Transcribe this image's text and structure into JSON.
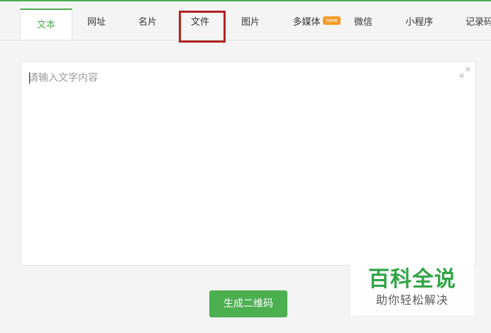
{
  "tabs": [
    {
      "label": "文本",
      "active": true
    },
    {
      "label": "网址",
      "active": false
    },
    {
      "label": "名片",
      "active": false
    },
    {
      "label": "文件",
      "active": false,
      "highlighted": true
    },
    {
      "label": "图片",
      "active": false
    },
    {
      "label": "多媒体",
      "active": false,
      "badge": "new"
    },
    {
      "label": "微信",
      "active": false
    },
    {
      "label": "小程序",
      "active": false
    },
    {
      "label": "记录码",
      "active": false
    }
  ],
  "editor": {
    "placeholder": "请输入文字内容",
    "value": ""
  },
  "generate_button": {
    "label": "生成二维码"
  },
  "watermark": {
    "title": "百科全说",
    "subtitle": "助你轻松解决"
  },
  "colors": {
    "accent": "#4caf50",
    "highlight_border": "#b22222",
    "badge": "#f59a23"
  }
}
